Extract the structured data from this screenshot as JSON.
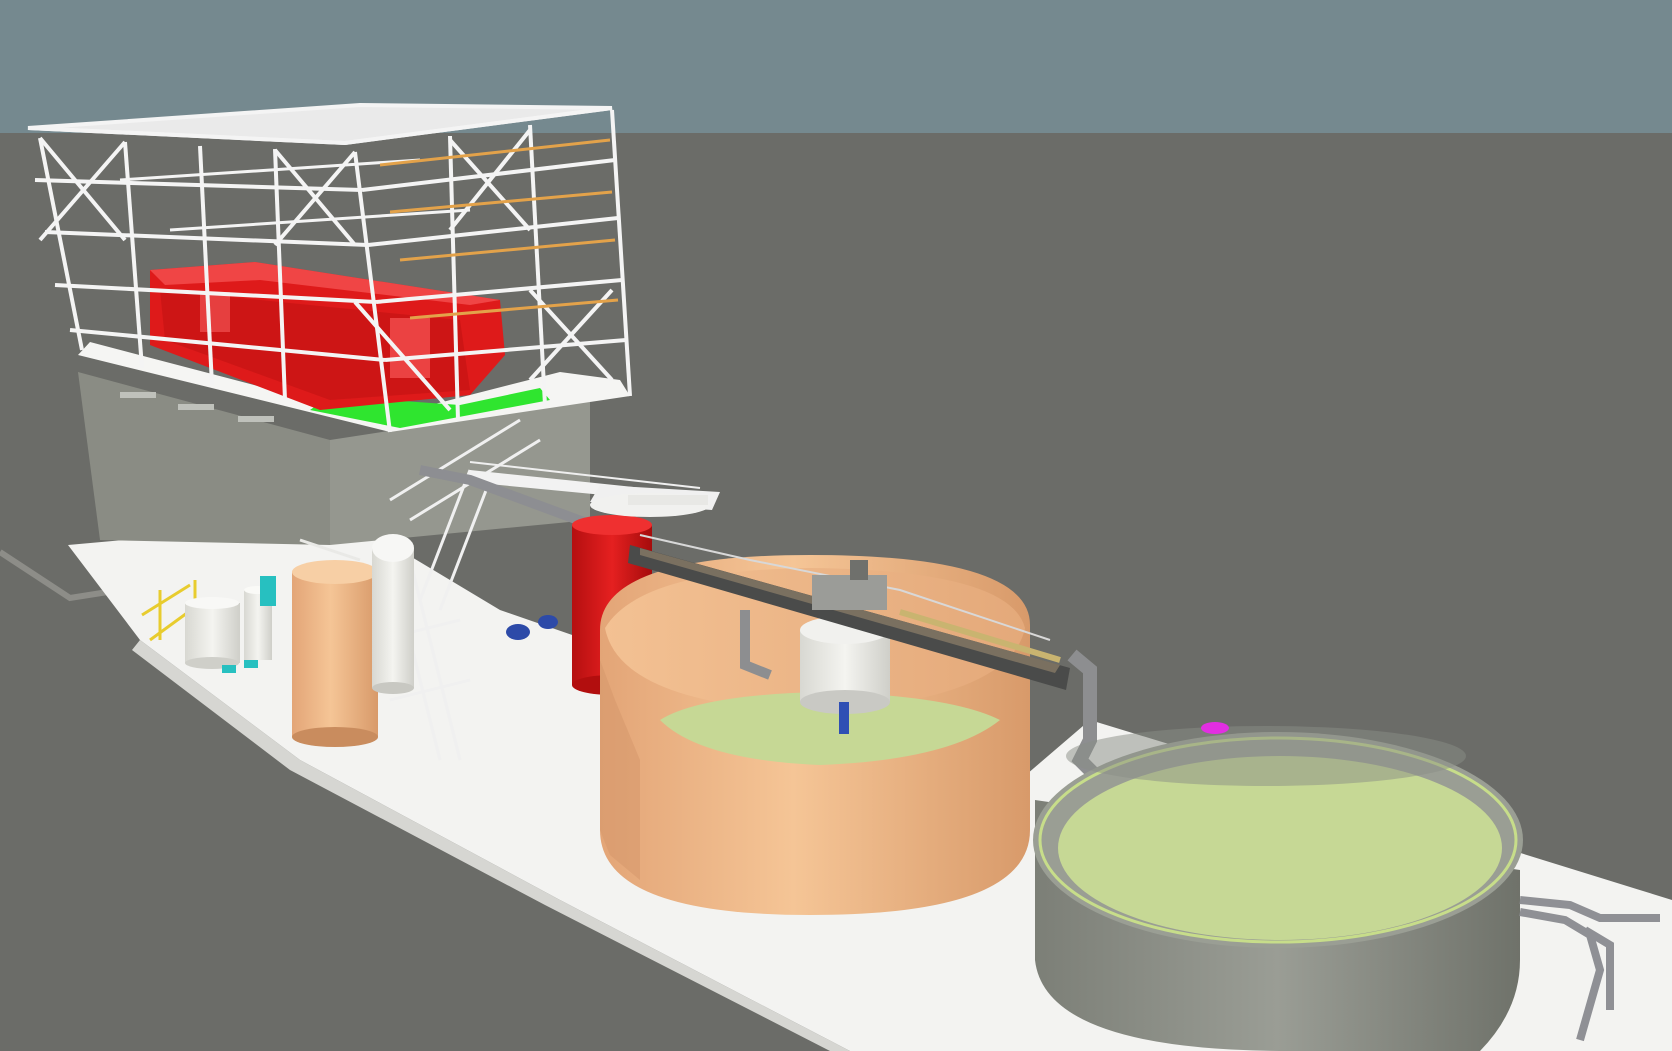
{
  "scene": {
    "sky_color": "#75898f",
    "ground_color": "#6b6c68",
    "platform_color": "#f2f2f2",
    "frame_color": "#f4f4f4",
    "press_color": "#e01818",
    "floor_color": "#2ee62e",
    "tank_tan_color": "#f2bb8a",
    "liquid_color": "#c6d895",
    "concrete_color": "#8a8d85",
    "pipe_color": "#8f9095"
  }
}
